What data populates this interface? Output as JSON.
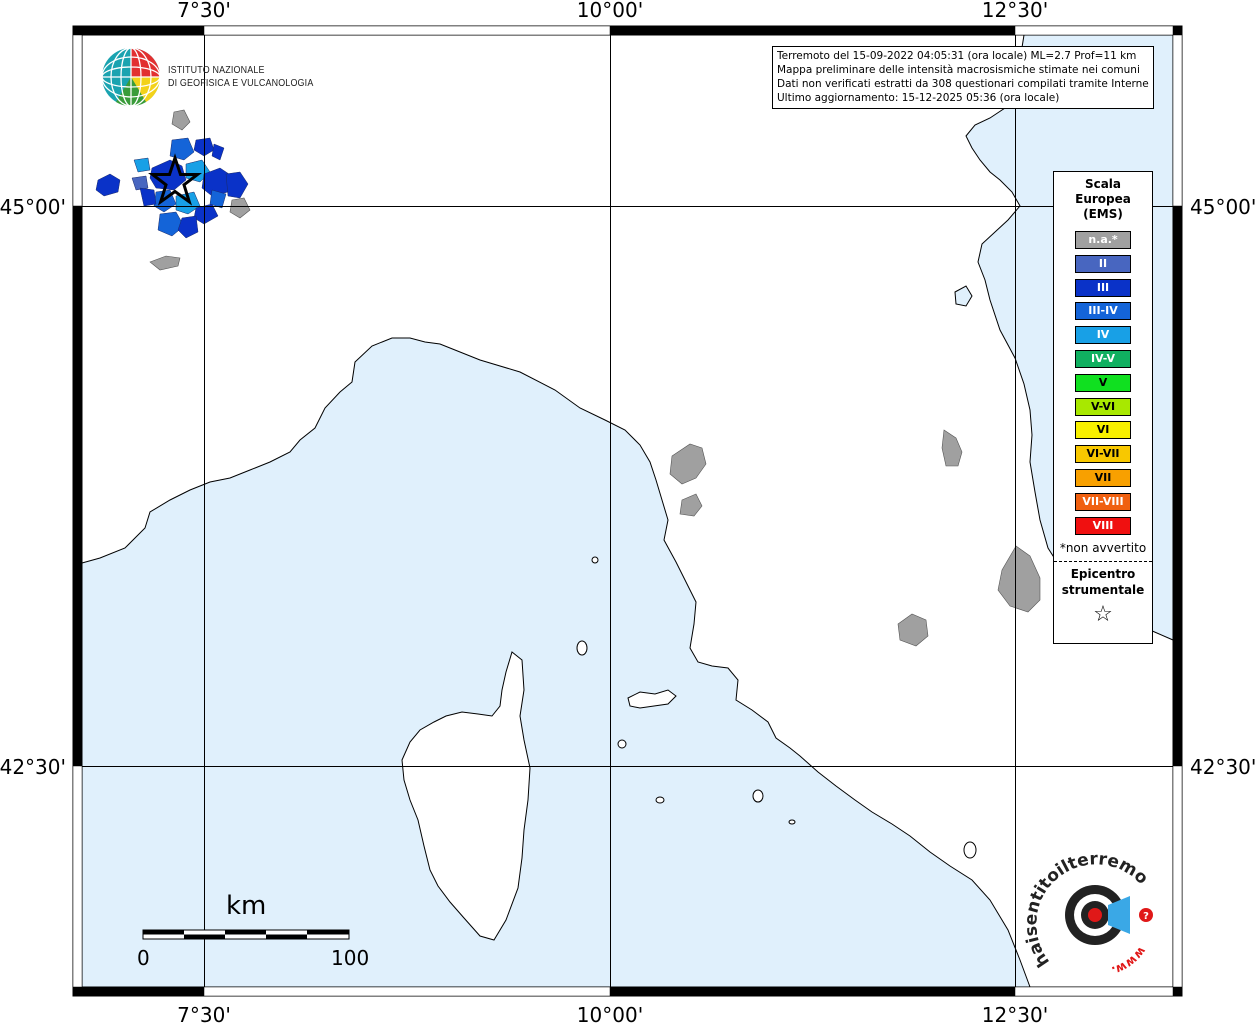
{
  "map": {
    "latitude_labels": [
      "45°00'",
      "42°30'"
    ],
    "longitude_labels": [
      "7°30'",
      "10°00'",
      "12°30'"
    ],
    "colors": {
      "sea": "#e0f0fc",
      "land": "#ffffff",
      "coastline": "#000000",
      "grid": "#000000",
      "na_gray": "#a0a0a0"
    }
  },
  "organization": {
    "logo_name": "ingv-globe-logo",
    "name_line1": "ISTITUTO NAZIONALE",
    "name_line2": "DI GEOFISICA E VULCANOLOGIA"
  },
  "info": {
    "line1": "Terremoto del 15-09-2022 04:05:31 (ora locale) ML=2.7 Prof=11 km",
    "line2": "Mappa preliminare delle intensità macrosismiche stimate nei comuni",
    "line3": "Dati non verificati estratti da 308 questionari compilati tramite Internet.",
    "line4": "Ultimo aggiornamento: 15-12-2025 05:36 (ora locale)"
  },
  "legend": {
    "title_line1": "Scala",
    "title_line2": "Europea",
    "title_line3": "(EMS)",
    "items": [
      {
        "label": "n.a.*",
        "color": "#a0a0a0"
      },
      {
        "label": "II",
        "color": "#4866c0"
      },
      {
        "label": "III",
        "color": "#0a32c8"
      },
      {
        "label": "III-IV",
        "color": "#1464d8"
      },
      {
        "label": "IV",
        "color": "#18a0e6"
      },
      {
        "label": "IV-V",
        "color": "#10b060"
      },
      {
        "label": "V",
        "color": "#10e020"
      },
      {
        "label": "V-VI",
        "color": "#a8e800"
      },
      {
        "label": "VI",
        "color": "#f8f000"
      },
      {
        "label": "VI-VII",
        "color": "#f8c800"
      },
      {
        "label": "VII",
        "color": "#f8a000"
      },
      {
        "label": "VII-VIII",
        "color": "#f06010"
      },
      {
        "label": "VIII",
        "color": "#f01010"
      }
    ],
    "note": "*non avvertito",
    "epicenter_line1": "Epicentro",
    "epicenter_line2": "strumentale",
    "epicenter_symbol": "☆"
  },
  "scale_bar": {
    "unit": "km",
    "start": "0",
    "end": "100"
  },
  "brand_logo": {
    "name": "haisentitoilterremoto-logo",
    "text": "haisentitoilterremoto.it",
    "url_text": "www.",
    "question": "?"
  }
}
